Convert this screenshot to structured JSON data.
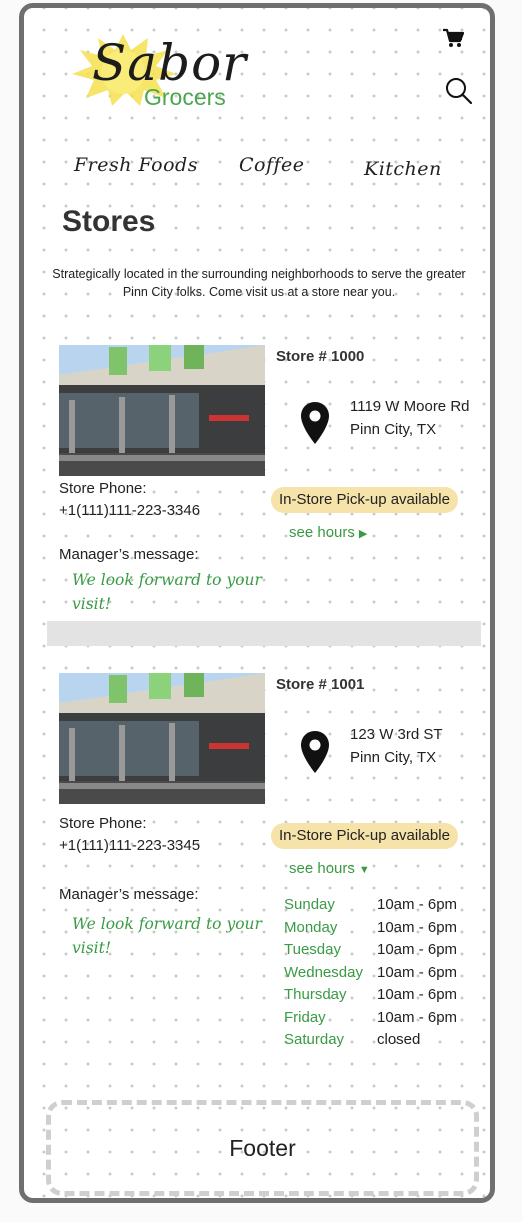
{
  "header": {
    "logo_main": "Sabor",
    "logo_sub": "Grocers",
    "cart_icon": "cart-icon",
    "search_icon": "search-icon"
  },
  "nav": {
    "items": [
      {
        "label": "Fresh Foods"
      },
      {
        "label": "Coffee"
      },
      {
        "label": "Kitchen"
      }
    ]
  },
  "page": {
    "title": "Stores",
    "intro": "Strategically located in the surrounding neighborhoods to serve the greater Pinn City folks. Come visit us at a store near you."
  },
  "stores": [
    {
      "number": "Store # 1000",
      "address_line1": "1119 W Moore Rd",
      "address_line2": "Pinn City, TX",
      "phone_label": "Store Phone:",
      "phone": "+1(111)111-223-3346",
      "pickup": "In-Store Pick-up available",
      "hours_link": "see hours",
      "hours_arrow": "▶",
      "manager_label": "Manager’s message:",
      "manager_message": "We look forward to your visit!"
    },
    {
      "number": "Store # 1001",
      "address_line1": "123 W 3rd ST",
      "address_line2": "Pinn City, TX",
      "phone_label": "Store Phone:",
      "phone": "+1(111)111-223-3345",
      "pickup": "In-Store Pick-up available",
      "hours_link": "see hours",
      "hours_arrow": "▼",
      "manager_label": "Manager’s message:",
      "manager_message": "We look forward to your visit!",
      "hours": [
        {
          "day": "Sunday",
          "time": "10am - 6pm"
        },
        {
          "day": "Monday",
          "time": "10am - 6pm"
        },
        {
          "day": "Tuesday",
          "time": "10am - 6pm"
        },
        {
          "day": "Wednesday",
          "time": "10am - 6pm"
        },
        {
          "day": "Thursday",
          "time": "10am - 6pm"
        },
        {
          "day": "Friday",
          "time": "10am - 6pm"
        },
        {
          "day": "Saturday",
          "time": "closed"
        }
      ]
    }
  ],
  "footer": {
    "label": "Footer"
  },
  "colors": {
    "accent_green": "#3a9b45",
    "badge_yellow": "#f6e3a9",
    "logo_yellow": "#f4e04d"
  }
}
